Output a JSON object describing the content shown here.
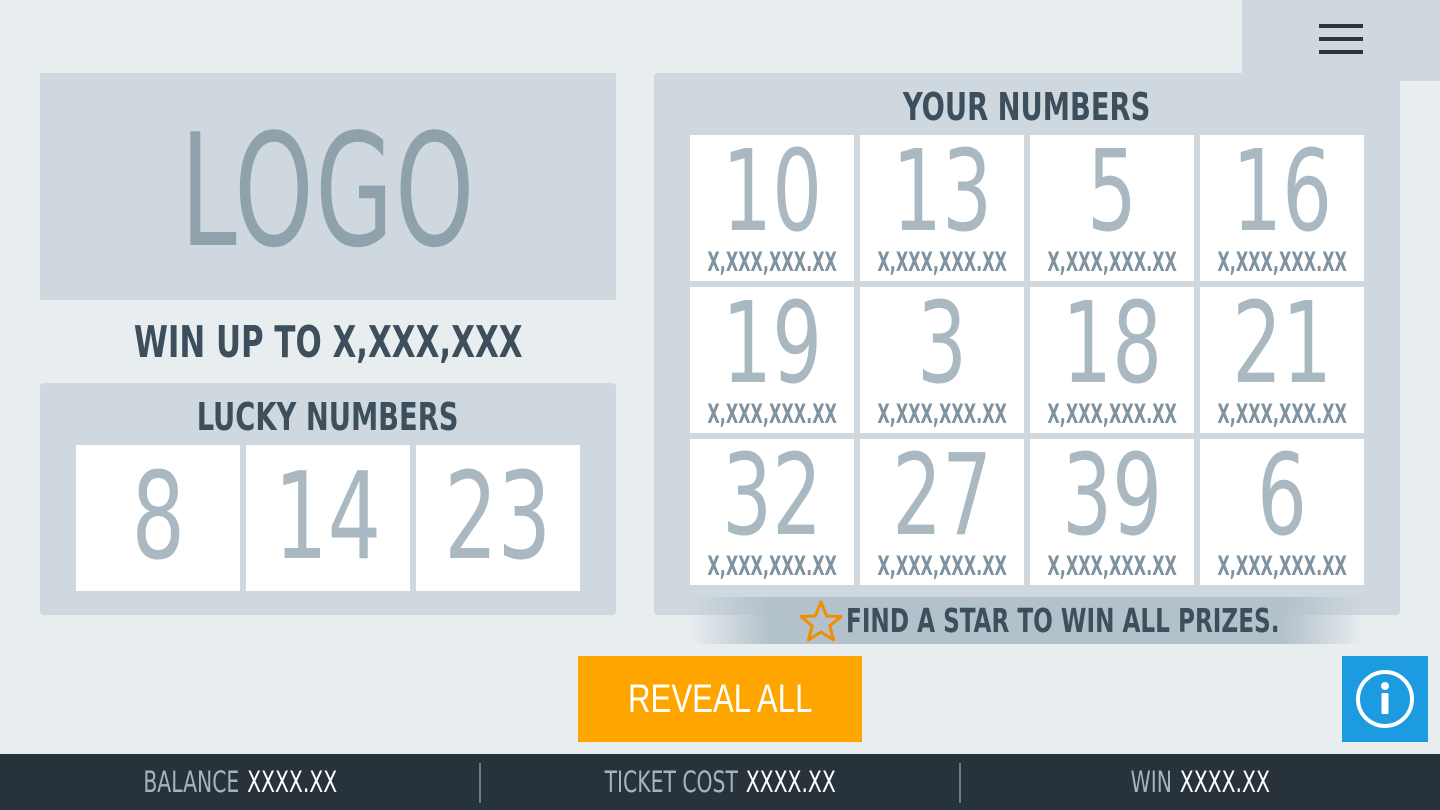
{
  "menu": {
    "icon": "hamburger-menu-icon"
  },
  "logo": {
    "text": "LOGO"
  },
  "win_up_to": "WIN UP TO X,XXX,XXX",
  "lucky": {
    "title": "LUCKY NUMBERS",
    "numbers": [
      "8",
      "14",
      "23"
    ]
  },
  "yours": {
    "title": "YOUR NUMBERS",
    "cells": [
      {
        "number": "10",
        "prize": "X,XXX,XXX.XX"
      },
      {
        "number": "13",
        "prize": "X,XXX,XXX.XX"
      },
      {
        "number": "5",
        "prize": "X,XXX,XXX.XX"
      },
      {
        "number": "16",
        "prize": "X,XXX,XXX.XX"
      },
      {
        "number": "19",
        "prize": "X,XXX,XXX.XX"
      },
      {
        "number": "3",
        "prize": "X,XXX,XXX.XX"
      },
      {
        "number": "18",
        "prize": "X,XXX,XXX.XX"
      },
      {
        "number": "21",
        "prize": "X,XXX,XXX.XX"
      },
      {
        "number": "32",
        "prize": "X,XXX,XXX.XX"
      },
      {
        "number": "27",
        "prize": "X,XXX,XXX.XX"
      },
      {
        "number": "39",
        "prize": "X,XXX,XXX.XX"
      },
      {
        "number": "6",
        "prize": "X,XXX,XXX.XX"
      }
    ]
  },
  "star_banner": {
    "text": "FIND A STAR TO WIN ALL PRIZES.",
    "icon": "star-icon"
  },
  "reveal_button": "REVEAL ALL",
  "info_button": {
    "icon": "info-icon"
  },
  "footer": {
    "balance_label": "BALANCE",
    "balance_value": "XXXX.XX",
    "ticket_label": "TICKET COST",
    "ticket_value": "XXXX.XX",
    "win_label": "WIN",
    "win_value": "XXXX.XX"
  },
  "colors": {
    "background": "#e8edf0",
    "panel": "#cfd8df",
    "accent_orange": "#ffa500",
    "info_blue": "#1d9be0",
    "footer": "#27323b",
    "heading": "#3d4f5c"
  }
}
